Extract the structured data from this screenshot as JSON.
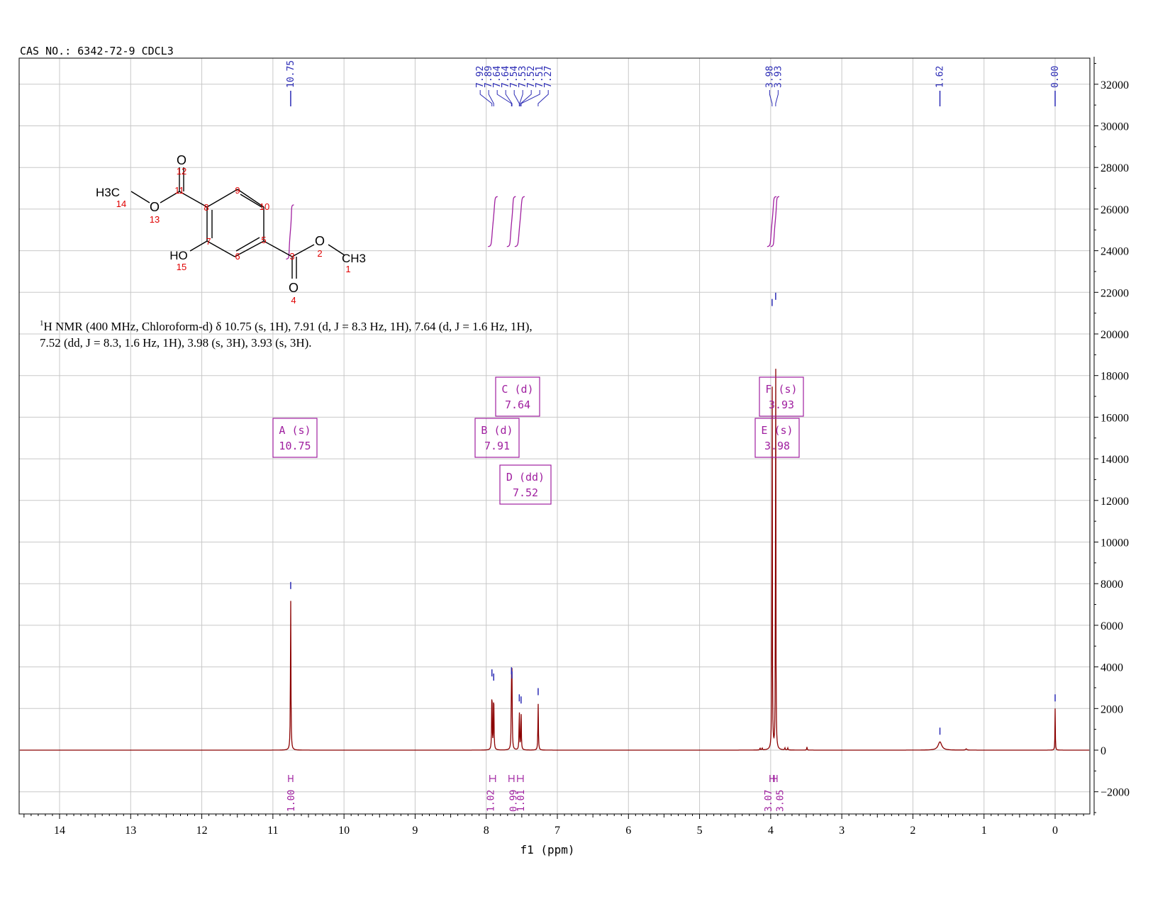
{
  "header": {
    "cas_label": "CAS NO.: 6342-72-9 CDCL3"
  },
  "description": {
    "line1_prefix": "1",
    "line1": "H NMR (400 MHz, Chloroform-d) δ 10.75 (s, 1H), 7.91 (d, J = 8.3 Hz, 1H), 7.64 (d, J = 1.6 Hz, 1H),",
    "line2": "7.52 (dd, J = 8.3, 1.6 Hz, 1H), 3.98 (s, 3H), 3.93 (s, 3H)."
  },
  "molecule": {
    "labels": [
      {
        "text": "O",
        "kind": "atom"
      },
      {
        "text": "12",
        "kind": "num"
      },
      {
        "text": "11",
        "kind": "num"
      },
      {
        "text": "H3C",
        "kind": "atom"
      },
      {
        "text": "14",
        "kind": "num"
      },
      {
        "text": "O",
        "kind": "atom"
      },
      {
        "text": "13",
        "kind": "num"
      },
      {
        "text": "8",
        "kind": "num"
      },
      {
        "text": "9",
        "kind": "num"
      },
      {
        "text": "10",
        "kind": "num"
      },
      {
        "text": "7",
        "kind": "num"
      },
      {
        "text": "6",
        "kind": "num"
      },
      {
        "text": "5",
        "kind": "num"
      },
      {
        "text": "HO",
        "kind": "atom"
      },
      {
        "text": "15",
        "kind": "num"
      },
      {
        "text": "3",
        "kind": "num"
      },
      {
        "text": "O",
        "kind": "atom"
      },
      {
        "text": "2",
        "kind": "num"
      },
      {
        "text": "CH3",
        "kind": "atom"
      },
      {
        "text": "1",
        "kind": "num"
      },
      {
        "text": "O",
        "kind": "atom"
      },
      {
        "text": "4",
        "kind": "num"
      }
    ]
  },
  "colors": {
    "spectrum": "#8b0000",
    "peak_label": "#2b2bb5",
    "integral": "#a020a0",
    "grid": "#c8c8c8",
    "axis": "#000000",
    "atom_number": "#e00000"
  },
  "chart_data": {
    "type": "line",
    "title": "",
    "xlabel": "f1 (ppm)",
    "ylabel": "",
    "xlim": [
      14.5,
      -0.45
    ],
    "ylim": [
      -3100,
      33000
    ],
    "x_reversed": true,
    "grid": true,
    "x_ticks": [
      "14",
      "13",
      "12",
      "11",
      "10",
      "9",
      "8",
      "7",
      "6",
      "5",
      "4",
      "3",
      "2",
      "1",
      "0"
    ],
    "y_ticks": [
      "32000",
      "30000",
      "28000",
      "26000",
      "24000",
      "22000",
      "20000",
      "18000",
      "16000",
      "14000",
      "12000",
      "10000",
      "8000",
      "6000",
      "4000",
      "2000",
      "0",
      "-2000"
    ],
    "peaks": [
      {
        "ppm": 10.75,
        "height": 7400,
        "width": 0.004
      },
      {
        "ppm": 7.92,
        "height": 3200,
        "width": 0.004
      },
      {
        "ppm": 7.895,
        "height": 3000,
        "width": 0.004
      },
      {
        "ppm": 7.645,
        "height": 3300,
        "width": 0.004
      },
      {
        "ppm": 7.638,
        "height": 3100,
        "width": 0.004
      },
      {
        "ppm": 7.535,
        "height": 2000,
        "width": 0.004
      },
      {
        "ppm": 7.51,
        "height": 1900,
        "width": 0.004
      },
      {
        "ppm": 7.27,
        "height": 2300,
        "width": 0.004
      },
      {
        "ppm": 3.98,
        "height": 21000,
        "width": 0.003
      },
      {
        "ppm": 3.93,
        "height": 21300,
        "width": 0.003
      },
      {
        "ppm": 4.15,
        "height": 100,
        "width": 0.004
      },
      {
        "ppm": 4.12,
        "height": 100,
        "width": 0.004
      },
      {
        "ppm": 3.8,
        "height": 100,
        "width": 0.004
      },
      {
        "ppm": 3.76,
        "height": 100,
        "width": 0.004
      },
      {
        "ppm": 3.49,
        "height": 150,
        "width": 0.004
      },
      {
        "ppm": 1.62,
        "height": 400,
        "width": 0.03
      },
      {
        "ppm": 1.25,
        "height": 60,
        "width": 0.01
      },
      {
        "ppm": 0.0,
        "height": 2000,
        "width": 0.003
      }
    ],
    "peak_labels": [
      {
        "group": 1,
        "values": [
          "10.75"
        ],
        "x": [
          10.75
        ]
      },
      {
        "group": 2,
        "values": [
          "7.92",
          "7.89",
          "7.64",
          "7.64",
          "7.54",
          "7.53",
          "7.52",
          "7.51",
          "7.27"
        ],
        "x": [
          7.92,
          7.895,
          7.645,
          7.638,
          7.535,
          7.53,
          7.515,
          7.51,
          7.27
        ]
      },
      {
        "group": 3,
        "values": [
          "3.98",
          "3.93"
        ],
        "x": [
          3.98,
          3.93
        ]
      },
      {
        "group": 4,
        "values": [
          "1.62"
        ],
        "x": [
          1.62
        ]
      },
      {
        "group": 5,
        "values": [
          "0.00"
        ],
        "x": [
          0.0
        ]
      }
    ],
    "integrals": [
      {
        "from": 10.78,
        "to": 10.72,
        "value": "1.00"
      },
      {
        "from": 7.95,
        "to": 7.87,
        "value": "1.02"
      },
      {
        "from": 7.68,
        "to": 7.61,
        "value": "0.99"
      },
      {
        "from": 7.56,
        "to": 7.48,
        "value": "1.01"
      },
      {
        "from": 4.01,
        "to": 3.95,
        "value": "3.07"
      },
      {
        "from": 3.96,
        "to": 3.91,
        "value": "3.05"
      }
    ],
    "annotations": [
      {
        "letter": "A (s)",
        "shift": "10.75"
      },
      {
        "letter": "B (d)",
        "shift": "7.91"
      },
      {
        "letter": "C (d)",
        "shift": "7.64"
      },
      {
        "letter": "D (dd)",
        "shift": "7.52"
      },
      {
        "letter": "E (s)",
        "shift": "3.98"
      },
      {
        "letter": "F (s)",
        "shift": "3.93"
      }
    ]
  }
}
